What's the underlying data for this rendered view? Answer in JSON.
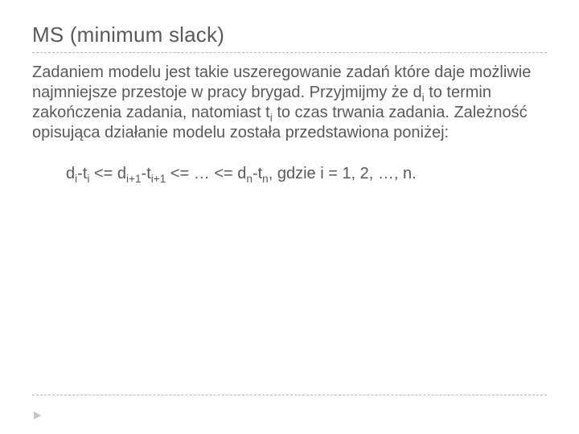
{
  "slide": {
    "title": "MS (minimum slack)",
    "paragraph": {
      "p1": "Zadaniem modelu jest takie uszeregowanie zadań które daje możliwie najmniejsze przestoje w pracy brygad.  Przyjmijmy że d",
      "sub1": "i",
      "p2": " to termin zakończenia zadania, natomiast t",
      "sub2": "i",
      "p3": " to czas trwania zadania. Zależność opisująca działanie modelu została przedstawiona poniżej:"
    },
    "formula": {
      "f1": "d",
      "s1": "i",
      "f2": "-t",
      "s2": "i",
      "f3": " <= d",
      "s3": "i+1",
      "f4": "-t",
      "s4": "i+1",
      "f5": " <= … <= d",
      "s5": "n",
      "f6": "-t",
      "s6": "n",
      "f7": ", gdzie i = 1, 2, …, n."
    }
  }
}
